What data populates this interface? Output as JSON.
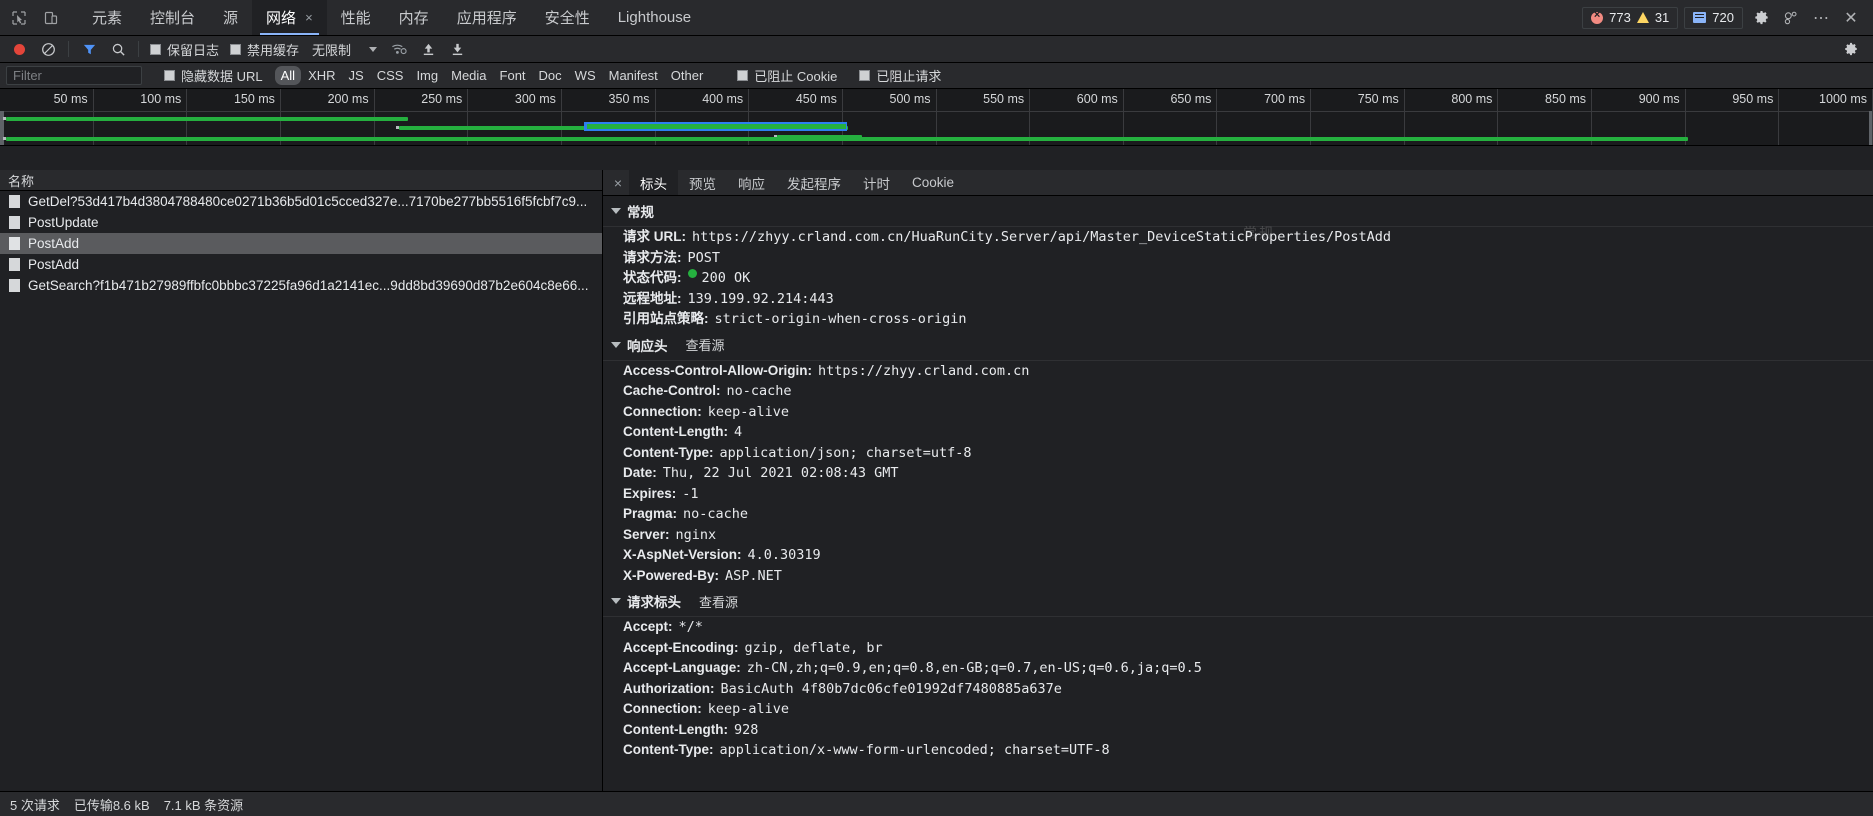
{
  "window": {
    "devtools_tabs": [
      {
        "label": "元素",
        "active": false
      },
      {
        "label": "控制台",
        "active": false
      },
      {
        "label": "源",
        "active": false
      },
      {
        "label": "网络",
        "active": true,
        "closable": true
      },
      {
        "label": "性能",
        "active": false
      },
      {
        "label": "内存",
        "active": false
      },
      {
        "label": "应用程序",
        "active": false
      },
      {
        "label": "安全性",
        "active": false
      },
      {
        "label": "Lighthouse",
        "active": false
      }
    ],
    "close_tab_glyph": "×",
    "counters": {
      "errors": "773",
      "warnings": "31",
      "messages": "720"
    },
    "right_buttons": {
      "settings": "⚙",
      "devices": "dock-icon",
      "more": "⋯",
      "close": "✕"
    }
  },
  "network_toolbar": {
    "record_title": "record",
    "clear_glyph": "⊘",
    "filter_glyph": "filter",
    "search_glyph": "search",
    "preserve_log": "保留日志",
    "disable_cache": "禁用缓存",
    "throttling": "无限制",
    "import_glyph": "import",
    "export_glyph": "export",
    "settings_glyph": "⚙"
  },
  "filter_bar": {
    "placeholder": "Filter",
    "value": "",
    "hide_data_urls": "隐藏数据 URL",
    "types": [
      {
        "label": "All",
        "selected": true
      },
      {
        "label": "XHR",
        "selected": false
      },
      {
        "label": "JS",
        "selected": false
      },
      {
        "label": "CSS",
        "selected": false
      },
      {
        "label": "Img",
        "selected": false
      },
      {
        "label": "Media",
        "selected": false
      },
      {
        "label": "Font",
        "selected": false
      },
      {
        "label": "Doc",
        "selected": false
      },
      {
        "label": "WS",
        "selected": false
      },
      {
        "label": "Manifest",
        "selected": false
      },
      {
        "label": "Other",
        "selected": false
      }
    ],
    "blocked_cookies": "已阻止 Cookie",
    "blocked_requests": "已阻止请求"
  },
  "overview": {
    "ticks": [
      "50 ms",
      "100 ms",
      "150 ms",
      "200 ms",
      "250 ms",
      "300 ms",
      "350 ms",
      "400 ms",
      "450 ms",
      "500 ms",
      "550 ms",
      "600 ms",
      "650 ms",
      "700 ms",
      "750 ms",
      "800 ms",
      "850 ms",
      "900 ms",
      "950 ms",
      "1000 ms"
    ],
    "bars": [
      {
        "left_pct": 0.3,
        "width_pct": 21.5,
        "selected": false
      },
      {
        "left_pct": 21.3,
        "width_pct": 24.0,
        "selected": false
      },
      {
        "left_pct": 31.2,
        "width_pct": 14.0,
        "selected": true
      },
      {
        "left_pct": 41.5,
        "width_pct": 4.5,
        "selected": false
      },
      {
        "left_pct": 0.3,
        "width_pct": 89.8,
        "selected": false
      }
    ]
  },
  "request_list": {
    "column_header": "名称",
    "rows": [
      {
        "name": "GetDel?53d417b4d3804788480ce0271b36b5d01c5cced327e...7170be277bb5516f5fcbf7c9...",
        "selected": false
      },
      {
        "name": "PostUpdate",
        "selected": false
      },
      {
        "name": "PostAdd",
        "selected": true
      },
      {
        "name": "PostAdd",
        "selected": false
      },
      {
        "name": "GetSearch?f1b471b27989ffbfc0bbbc37225fa96d1a2141ec...9dd8bd39690d87b2e604c8e66...",
        "selected": false
      }
    ]
  },
  "detail": {
    "close_glyph": "×",
    "tabs": [
      {
        "label": "标头",
        "active": true
      },
      {
        "label": "预览",
        "active": false
      },
      {
        "label": "响应",
        "active": false
      },
      {
        "label": "发起程序",
        "active": false
      },
      {
        "label": "计时",
        "active": false
      },
      {
        "label": "Cookie",
        "active": false
      }
    ],
    "watermark": "常规",
    "sections": [
      {
        "title": "常规",
        "view_source": "",
        "rows": [
          {
            "key": "请求 URL:",
            "value": "https://zhyy.crland.com.cn/HuaRunCity.Server/api/Master_DeviceStaticProperties/PostAdd",
            "status": false
          },
          {
            "key": "请求方法:",
            "value": "POST",
            "status": false
          },
          {
            "key": "状态代码:",
            "value": "200 OK",
            "status": true
          },
          {
            "key": "远程地址:",
            "value": "139.199.92.214:443",
            "status": false
          },
          {
            "key": "引用站点策略:",
            "value": "strict-origin-when-cross-origin",
            "status": false
          }
        ]
      },
      {
        "title": "响应头",
        "view_source": "查看源",
        "rows": [
          {
            "key": "Access-Control-Allow-Origin:",
            "value": "https://zhyy.crland.com.cn",
            "status": false
          },
          {
            "key": "Cache-Control:",
            "value": "no-cache",
            "status": false
          },
          {
            "key": "Connection:",
            "value": "keep-alive",
            "status": false
          },
          {
            "key": "Content-Length:",
            "value": "4",
            "status": false
          },
          {
            "key": "Content-Type:",
            "value": "application/json; charset=utf-8",
            "status": false
          },
          {
            "key": "Date:",
            "value": "Thu, 22 Jul 2021 02:08:43 GMT",
            "status": false
          },
          {
            "key": "Expires:",
            "value": "-1",
            "status": false
          },
          {
            "key": "Pragma:",
            "value": "no-cache",
            "status": false
          },
          {
            "key": "Server:",
            "value": "nginx",
            "status": false
          },
          {
            "key": "X-AspNet-Version:",
            "value": "4.0.30319",
            "status": false
          },
          {
            "key": "X-Powered-By:",
            "value": "ASP.NET",
            "status": false
          }
        ]
      },
      {
        "title": "请求标头",
        "view_source": "查看源",
        "rows": [
          {
            "key": "Accept:",
            "value": "*/*",
            "status": false
          },
          {
            "key": "Accept-Encoding:",
            "value": "gzip, deflate, br",
            "status": false
          },
          {
            "key": "Accept-Language:",
            "value": "zh-CN,zh;q=0.9,en;q=0.8,en-GB;q=0.7,en-US;q=0.6,ja;q=0.5",
            "status": false
          },
          {
            "key": "Authorization:",
            "value": "BasicAuth 4f80b7dc06cfe01992df7480885a637e",
            "status": false
          },
          {
            "key": "Connection:",
            "value": "keep-alive",
            "status": false
          },
          {
            "key": "Content-Length:",
            "value": "928",
            "status": false
          },
          {
            "key": "Content-Type:",
            "value": "application/x-www-form-urlencoded; charset=UTF-8",
            "status": false
          }
        ]
      }
    ]
  },
  "status_bar": {
    "requests": "5 次请求",
    "transferred": "已传输8.6 kB",
    "resources": "7.1 kB 条资源"
  }
}
